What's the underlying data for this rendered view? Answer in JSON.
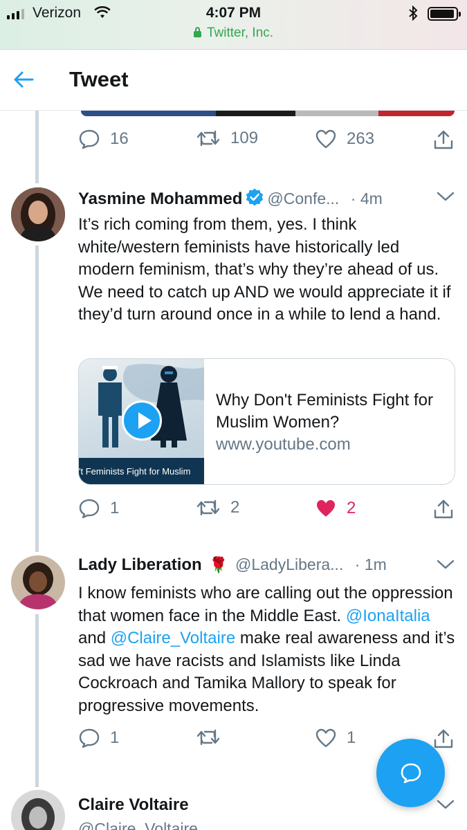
{
  "status_bar": {
    "carrier": "Verizon",
    "time": "4:07 PM",
    "site": "Twitter, Inc."
  },
  "header": {
    "title": "Tweet"
  },
  "colors": {
    "accent": "#1da1f2",
    "like": "#e0245e",
    "secure_green": "#2fa84f",
    "muted": "#657786"
  },
  "previous_tweet": {
    "replies": "16",
    "retweets": "109",
    "likes": "263"
  },
  "tweets": [
    {
      "name": "Yasmine Mohammed",
      "verified": true,
      "handle": "@Confe...",
      "time": "· 4m",
      "text": "It’s rich coming from them, yes. I think white/western feminists have historically led modern feminism, that’s why they’re ahead of us. We need to catch up AND we would appreciate it if they’d turn around once in a while to lend a hand.",
      "card": {
        "thumb_caption": "'t Feminists Fight for Muslim",
        "title": "Why Don't Feminists Fight for Muslim Women?",
        "domain": "www.youtube.com"
      },
      "replies": "1",
      "retweets": "2",
      "likes": "2",
      "liked": true
    },
    {
      "name": "Lady Liberation",
      "emoji": "🌹",
      "handle": "@LadyLibera...",
      "time": "· 1m",
      "text_parts": {
        "a": "I know feminists who are calling out the oppression that women face in the Middle East. ",
        "mention1": "@IonaItalia",
        "b": " and ",
        "mention2": "@Claire_Voltaire",
        "c": " make real awareness and it’s sad we have racists and Islamists like Linda Cockroach and Tamika Mallory to speak for progressive movements."
      },
      "replies": "1",
      "retweets": "",
      "likes": "1",
      "liked": false
    },
    {
      "name": "Claire Voltaire",
      "handle": "@Claire_Voltaire"
    }
  ],
  "icons": {
    "back": "arrow-left-icon",
    "reply": "speech-bubble-icon",
    "retweet": "retweet-icon",
    "like": "heart-icon",
    "share": "share-icon",
    "menu": "chevron-down-icon",
    "compose": "compose-reply-icon"
  }
}
